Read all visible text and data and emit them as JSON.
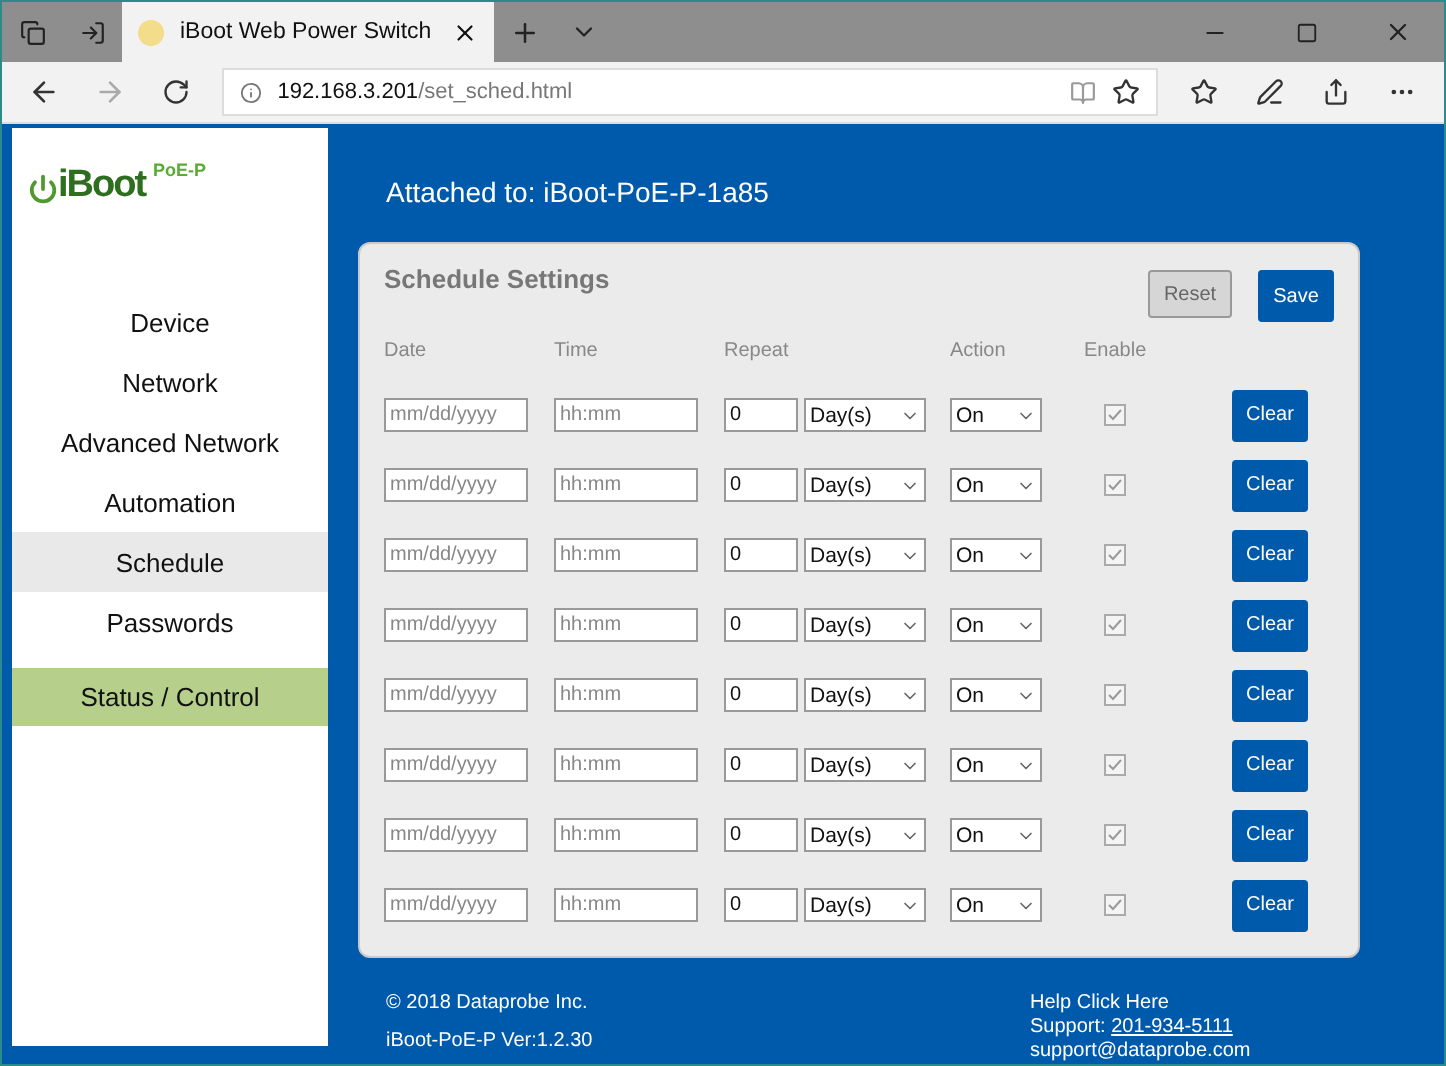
{
  "browser": {
    "tab_title": "iBoot Web Power Switch",
    "url_host": "192.168.3.201",
    "url_path": "/set_sched.html"
  },
  "logo": {
    "name": "iBoot",
    "badge": "PoE-P"
  },
  "sidebar": {
    "items": [
      {
        "label": "Device",
        "selected": false,
        "kind": "link"
      },
      {
        "label": "Network",
        "selected": false,
        "kind": "link"
      },
      {
        "label": "Advanced Network",
        "selected": false,
        "kind": "link"
      },
      {
        "label": "Automation",
        "selected": false,
        "kind": "link"
      },
      {
        "label": "Schedule",
        "selected": true,
        "kind": "link"
      },
      {
        "label": "Passwords",
        "selected": false,
        "kind": "link"
      },
      {
        "label": "Status / Control",
        "selected": false,
        "kind": "status"
      }
    ]
  },
  "header": {
    "attached": "Attached to: iBoot-PoE-P-1a85"
  },
  "schedule": {
    "title": "Schedule Settings",
    "reset": "Reset",
    "save": "Save",
    "columns": [
      "Date",
      "Time",
      "Repeat",
      "Action",
      "Enable"
    ],
    "rows": [
      {
        "date_placeholder": "mm/dd/yyyy",
        "time_placeholder": "hh:mm",
        "repeat": "0",
        "unit": "Day(s)",
        "action": "On",
        "checked": true,
        "clear": "Clear"
      },
      {
        "date_placeholder": "mm/dd/yyyy",
        "time_placeholder": "hh:mm",
        "repeat": "0",
        "unit": "Day(s)",
        "action": "On",
        "checked": true,
        "clear": "Clear"
      },
      {
        "date_placeholder": "mm/dd/yyyy",
        "time_placeholder": "hh:mm",
        "repeat": "0",
        "unit": "Day(s)",
        "action": "On",
        "checked": true,
        "clear": "Clear"
      },
      {
        "date_placeholder": "mm/dd/yyyy",
        "time_placeholder": "hh:mm",
        "repeat": "0",
        "unit": "Day(s)",
        "action": "On",
        "checked": true,
        "clear": "Clear"
      },
      {
        "date_placeholder": "mm/dd/yyyy",
        "time_placeholder": "hh:mm",
        "repeat": "0",
        "unit": "Day(s)",
        "action": "On",
        "checked": true,
        "clear": "Clear"
      },
      {
        "date_placeholder": "mm/dd/yyyy",
        "time_placeholder": "hh:mm",
        "repeat": "0",
        "unit": "Day(s)",
        "action": "On",
        "checked": true,
        "clear": "Clear"
      },
      {
        "date_placeholder": "mm/dd/yyyy",
        "time_placeholder": "hh:mm",
        "repeat": "0",
        "unit": "Day(s)",
        "action": "On",
        "checked": true,
        "clear": "Clear"
      },
      {
        "date_placeholder": "mm/dd/yyyy",
        "time_placeholder": "hh:mm",
        "repeat": "0",
        "unit": "Day(s)",
        "action": "On",
        "checked": true,
        "clear": "Clear"
      }
    ]
  },
  "footer": {
    "copyright": "© 2018 Dataprobe Inc.",
    "version": "iBoot-PoE-P Ver:1.2.30",
    "help": "Help Click Here",
    "support_label": "Support:",
    "support_phone": "201-934-5111",
    "email": "support@dataprobe.com"
  }
}
